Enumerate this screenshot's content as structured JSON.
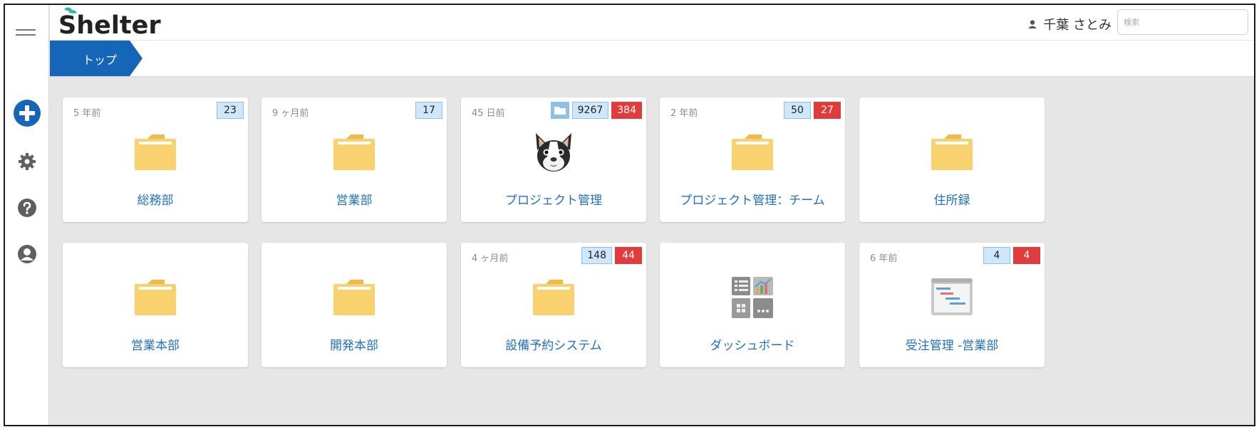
{
  "app": {
    "logo_text": "Shelter",
    "brand_color": "#1565b8",
    "link_color": "#1f6fc2"
  },
  "sidebar": {
    "items": [
      {
        "name": "menu-icon"
      },
      {
        "name": "add-icon"
      },
      {
        "name": "gear-icon"
      },
      {
        "name": "help-icon"
      },
      {
        "name": "user-icon"
      }
    ]
  },
  "header": {
    "user_name": "千葉 さとみ",
    "search_placeholder": "検索"
  },
  "breadcrumb": {
    "label": "トップ"
  },
  "cards": [
    {
      "age": "5 年前",
      "label": "総務部",
      "icon": "folder-icon",
      "counts": [
        "23"
      ],
      "alerts": []
    },
    {
      "age": "9 ヶ月前",
      "label": "営業部",
      "icon": "folder-icon",
      "counts": [
        "17"
      ],
      "alerts": []
    },
    {
      "age": "45 日前",
      "label": "プロジェクト管理",
      "icon": "dog-icon",
      "counts": [
        "9267"
      ],
      "alerts": [
        "384"
      ],
      "folder_badge": true
    },
    {
      "age": "2 年前",
      "label": "プロジェクト管理：チーム",
      "icon": "folder-icon",
      "counts": [
        "50"
      ],
      "alerts": [
        "27"
      ]
    },
    {
      "age": "",
      "label": "住所録",
      "icon": "folder-icon",
      "counts": [],
      "alerts": []
    },
    {
      "age": "",
      "label": "営業本部",
      "icon": "folder-icon",
      "counts": [],
      "alerts": []
    },
    {
      "age": "",
      "label": "開発本部",
      "icon": "folder-icon",
      "counts": [],
      "alerts": []
    },
    {
      "age": "4 ヶ月前",
      "label": "設備予約システム",
      "icon": "folder-icon",
      "counts": [
        "148"
      ],
      "alerts": [
        "44"
      ]
    },
    {
      "age": "",
      "label": "ダッシュボード",
      "icon": "dashboard-icon",
      "counts": [],
      "alerts": []
    },
    {
      "age": "6 年前",
      "label": "受注管理 -営業部",
      "icon": "gantt-icon",
      "counts": [
        "4"
      ],
      "alerts": [
        "4"
      ]
    }
  ]
}
